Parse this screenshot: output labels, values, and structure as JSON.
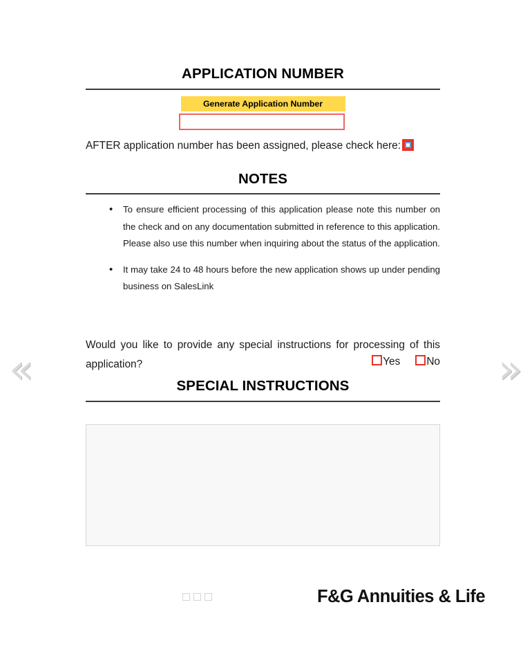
{
  "nav": {
    "prev_label": "«",
    "next_label": "»"
  },
  "application_number": {
    "heading": "APPLICATION NUMBER",
    "generate_button_label": "Generate Application Number",
    "input_value": "",
    "input_placeholder": "",
    "confirm_text": "AFTER application number has been assigned, please check here:",
    "confirm_checked": false
  },
  "notes": {
    "heading": "NOTES",
    "items": [
      "To ensure efficient processing of this application please note this number on the check and on any documentation submitted in reference to this application. Please also use this number when inquiring about the status of the application.",
      "It may take 24 to 48 hours before the new application shows up under pending business on SalesLink"
    ]
  },
  "question": {
    "text": "Would you like to provide any special instructions for processing of this application?",
    "options": [
      {
        "label": "Yes",
        "checked": false
      },
      {
        "label": "No",
        "checked": false
      }
    ]
  },
  "special_instructions": {
    "heading": "SPECIAL INSTRUCTIONS",
    "value": "",
    "placeholder": ""
  },
  "footer": {
    "brand": "F&G Annuities & Life",
    "page_dots": 3
  },
  "colors": {
    "button_yellow": "#ffd84c",
    "input_red": "#f2635c",
    "checkbox_red": "#e8312a",
    "checkbox_focus_blue": "#5b9bd5",
    "rule_dark": "#3a3a3a",
    "chevron_gray": "#d9d9d9",
    "textarea_fill": "#f8f8f8",
    "textarea_border": "#d6d6d6",
    "dot_border": "#d4d4d4"
  }
}
